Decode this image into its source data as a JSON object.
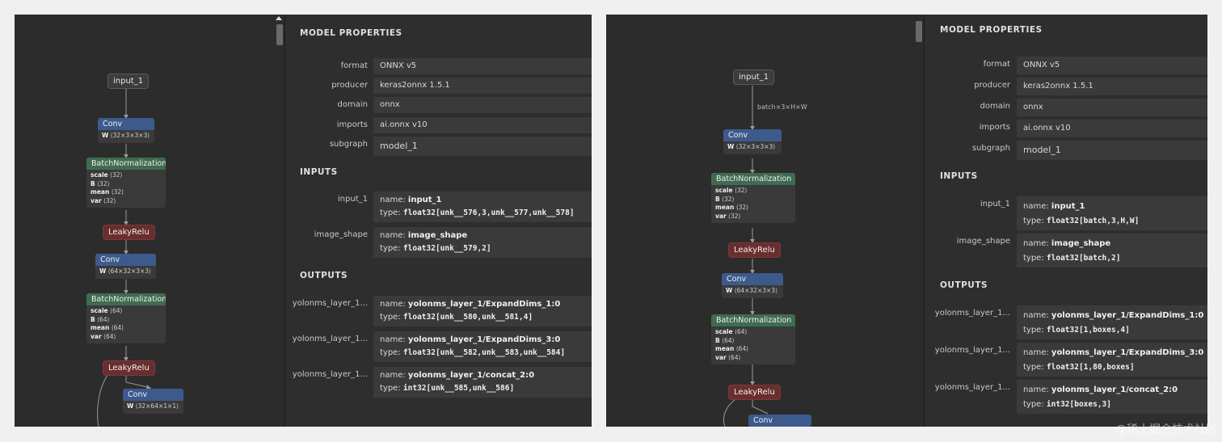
{
  "left": {
    "properties": {
      "title": "MODEL PROPERTIES",
      "rows": [
        {
          "label": "format",
          "value": "ONNX v5"
        },
        {
          "label": "producer",
          "value": "keras2onnx 1.5.1"
        },
        {
          "label": "domain",
          "value": "onnx"
        },
        {
          "label": "imports",
          "value": "ai.onnx v10"
        },
        {
          "label": "subgraph",
          "value": "model_1"
        }
      ],
      "inputs_title": "INPUTS",
      "inputs": [
        {
          "label": "input_1",
          "name_prefix": "name:",
          "name": "input_1",
          "type_prefix": "type:",
          "type": "float32[unk__576,3,unk__577,unk__578]"
        },
        {
          "label": "image_shape",
          "name_prefix": "name:",
          "name": "image_shape",
          "type_prefix": "type:",
          "type": "float32[unk__579,2]"
        }
      ],
      "outputs_title": "OUTPUTS",
      "outputs": [
        {
          "label": "yolonms_layer_1...",
          "name_prefix": "name:",
          "name": "yolonms_layer_1/ExpandDims_1:0",
          "type_prefix": "type:",
          "type": "float32[unk__580,unk__581,4]"
        },
        {
          "label": "yolonms_layer_1...",
          "name_prefix": "name:",
          "name": "yolonms_layer_1/ExpandDims_3:0",
          "type_prefix": "type:",
          "type": "float32[unk__582,unk__583,unk__584]"
        },
        {
          "label": "yolonms_layer_1...",
          "name_prefix": "name:",
          "name": "yolonms_layer_1/concat_2:0",
          "type_prefix": "type:",
          "type": "int32[unk__585,unk__586]"
        }
      ]
    },
    "graph": {
      "input": "input_1",
      "conv1": {
        "title": "Conv",
        "attr": "W",
        "shape": "⟨32×3×3×3⟩"
      },
      "bn1": {
        "title": "BatchNormalization",
        "attrs": [
          {
            "k": "scale",
            "v": "⟨32⟩"
          },
          {
            "k": "B",
            "v": "⟨32⟩"
          },
          {
            "k": "mean",
            "v": "⟨32⟩"
          },
          {
            "k": "var",
            "v": "⟨32⟩"
          }
        ]
      },
      "relu1": "LeakyRelu",
      "conv2": {
        "title": "Conv",
        "attr": "W",
        "shape": "⟨64×32×3×3⟩"
      },
      "bn2": {
        "title": "BatchNormalization",
        "attrs": [
          {
            "k": "scale",
            "v": "⟨64⟩"
          },
          {
            "k": "B",
            "v": "⟨64⟩"
          },
          {
            "k": "mean",
            "v": "⟨64⟩"
          },
          {
            "k": "var",
            "v": "⟨64⟩"
          }
        ]
      },
      "relu2": "LeakyRelu",
      "conv3": {
        "title": "Conv",
        "attr": "W",
        "shape": "⟨32×64×1×1⟩"
      }
    }
  },
  "right": {
    "properties": {
      "title": "MODEL PROPERTIES",
      "rows": [
        {
          "label": "format",
          "value": "ONNX v5"
        },
        {
          "label": "producer",
          "value": "keras2onnx 1.5.1"
        },
        {
          "label": "domain",
          "value": "onnx"
        },
        {
          "label": "imports",
          "value": "ai.onnx v10"
        },
        {
          "label": "subgraph",
          "value": "model_1"
        }
      ],
      "inputs_title": "INPUTS",
      "inputs": [
        {
          "label": "input_1",
          "name_prefix": "name:",
          "name": "input_1",
          "type_prefix": "type:",
          "type": "float32[batch,3,H,W]"
        },
        {
          "label": "image_shape",
          "name_prefix": "name:",
          "name": "image_shape",
          "type_prefix": "type:",
          "type": "float32[batch,2]"
        }
      ],
      "outputs_title": "OUTPUTS",
      "outputs": [
        {
          "label": "yolonms_layer_1...",
          "name_prefix": "name:",
          "name": "yolonms_layer_1/ExpandDims_1:0",
          "type_prefix": "type:",
          "type": "float32[1,boxes,4]"
        },
        {
          "label": "yolonms_layer_1...",
          "name_prefix": "name:",
          "name": "yolonms_layer_1/ExpandDims_3:0",
          "type_prefix": "type:",
          "type": "float32[1,80,boxes]"
        },
        {
          "label": "yolonms_layer_1...",
          "name_prefix": "name:",
          "name": "yolonms_layer_1/concat_2:0",
          "type_prefix": "type:",
          "type": "int32[boxes,3]"
        }
      ]
    },
    "graph": {
      "input": "input_1",
      "edge_label": "batch×3×H×W",
      "conv1": {
        "title": "Conv",
        "attr": "W",
        "shape": "⟨32×3×3×3⟩"
      },
      "bn1": {
        "title": "BatchNormalization",
        "attrs": [
          {
            "k": "scale",
            "v": "⟨32⟩"
          },
          {
            "k": "B",
            "v": "⟨32⟩"
          },
          {
            "k": "mean",
            "v": "⟨32⟩"
          },
          {
            "k": "var",
            "v": "⟨32⟩"
          }
        ]
      },
      "relu1": "LeakyRelu",
      "conv2": {
        "title": "Conv",
        "attr": "W",
        "shape": "⟨64×32×3×3⟩"
      },
      "bn2": {
        "title": "BatchNormalization",
        "attrs": [
          {
            "k": "scale",
            "v": "⟨64⟩"
          },
          {
            "k": "B",
            "v": "⟨64⟩"
          },
          {
            "k": "mean",
            "v": "⟨64⟩"
          },
          {
            "k": "var",
            "v": "⟨64⟩"
          }
        ]
      },
      "relu2": "LeakyRelu",
      "conv3": {
        "title": "Conv"
      }
    }
  },
  "watermark": "@稀土掘金技术社区"
}
